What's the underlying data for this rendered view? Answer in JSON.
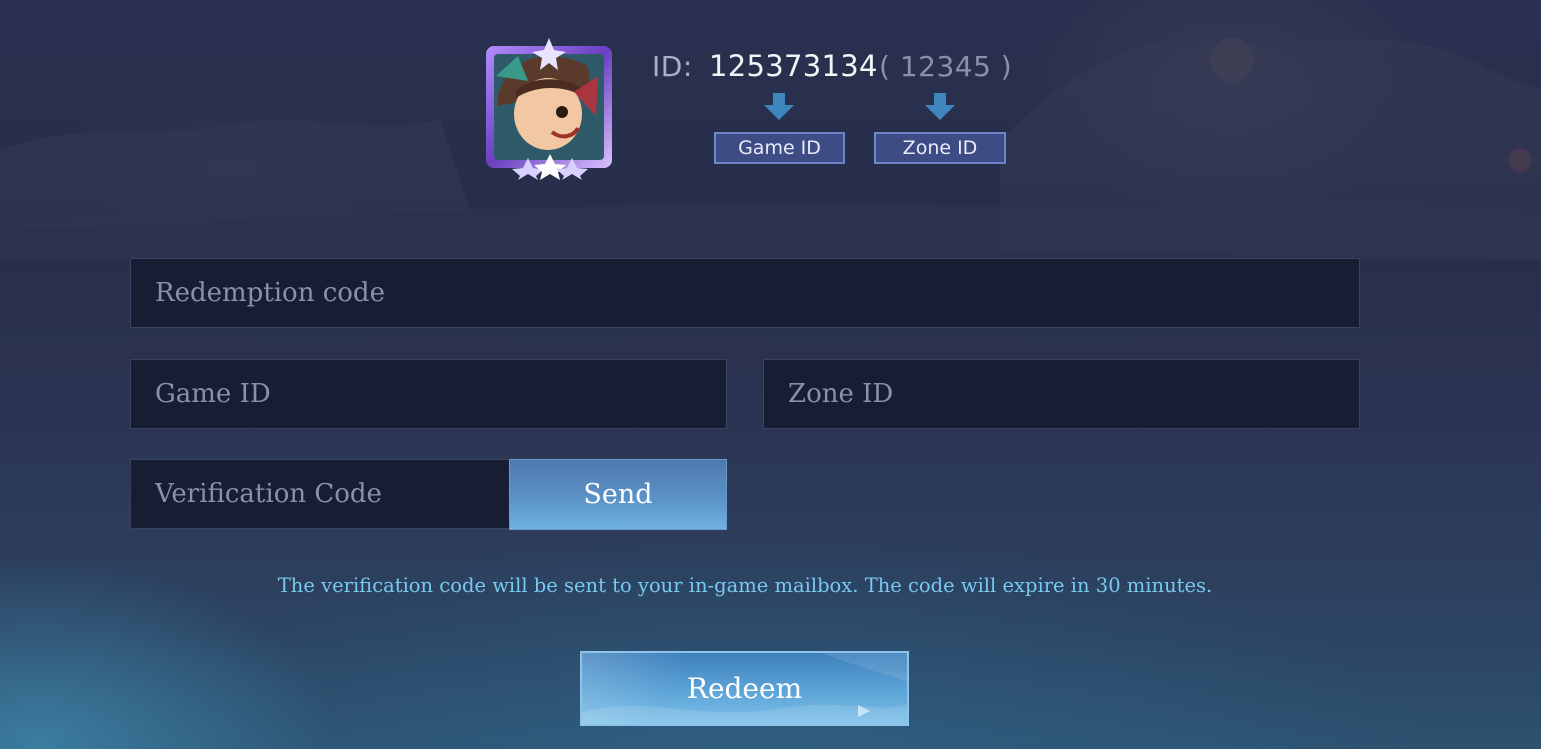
{
  "header": {
    "id_label": "ID:",
    "game_id_value": "125373134",
    "zone_id_value": "( 12345 )",
    "game_id_tag": "Game ID",
    "zone_id_tag": "Zone ID",
    "avatar_icon": "hero-avatar-icon",
    "arrow_icon": "arrow-down-icon"
  },
  "form": {
    "redemption_placeholder": "Redemption code",
    "game_id_placeholder": "Game ID",
    "zone_id_placeholder": "Zone ID",
    "verification_placeholder": "Verification Code",
    "send_label": "Send",
    "notice": "The verification code will be sent to your in-game mailbox. The code will expire in 30 minutes.",
    "redeem_label": "Redeem"
  },
  "colors": {
    "background": "#2a3150",
    "field_bg": "#171d33",
    "accent_blue": "#5a92c6",
    "notice_text": "#79c8ee"
  }
}
